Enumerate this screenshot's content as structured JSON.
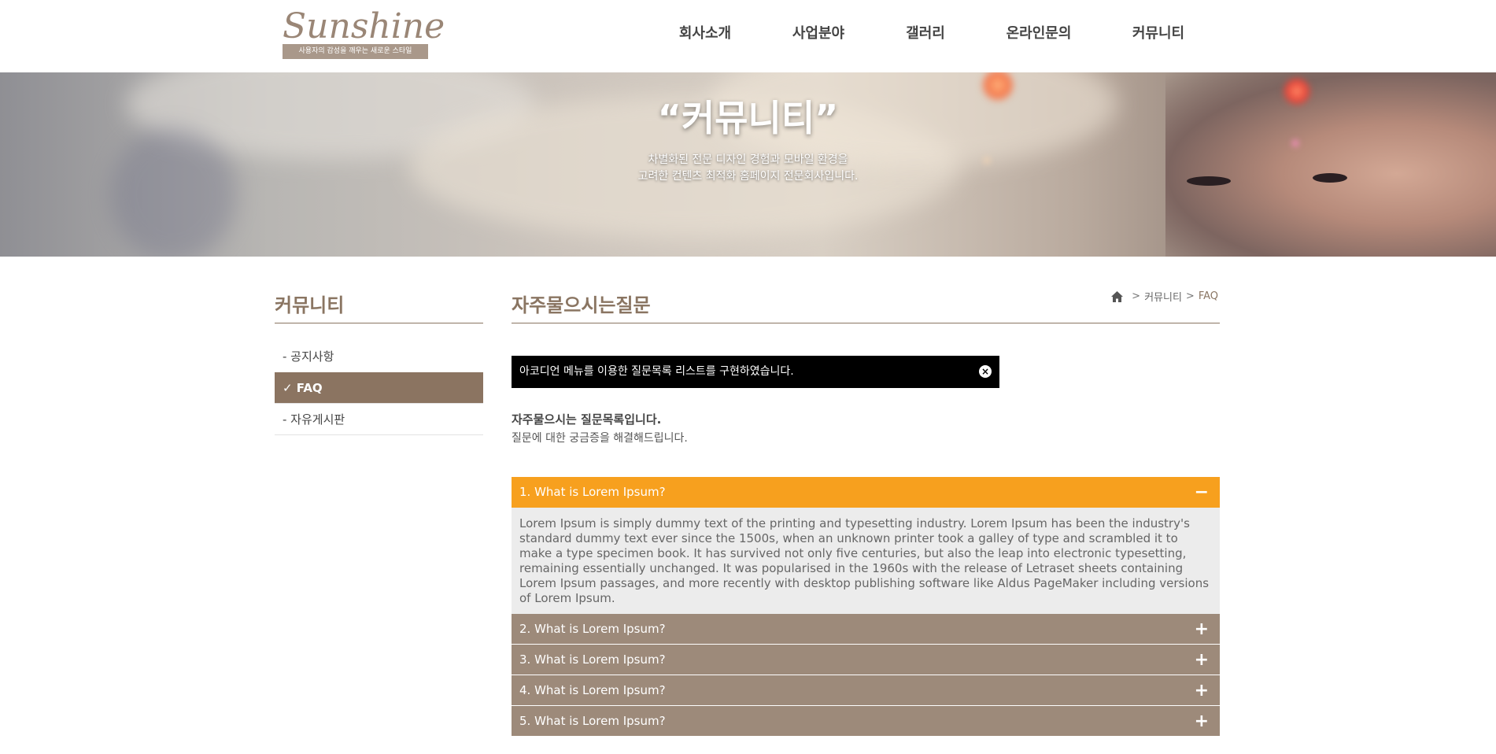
{
  "header": {
    "logo_text": "Sunshine",
    "logo_tagline": "사용자의 감성을 깨우는 새로운 스타일",
    "nav": [
      {
        "label": "회사소개"
      },
      {
        "label": "사업분야"
      },
      {
        "label": "갤러리"
      },
      {
        "label": "온라인문의"
      },
      {
        "label": "커뮤니티"
      }
    ]
  },
  "banner": {
    "title": "“커뮤니티”",
    "subtitle_line1": "차별화된 전문 디자인 경험과 모바일 환경을",
    "subtitle_line2": "고려한 컨텐츠 최적화 홈페이지 전문회사입니다."
  },
  "sidebar": {
    "title": "커뮤니티",
    "items": [
      {
        "label": "- 공지사항",
        "active": false
      },
      {
        "label": "✓ FAQ",
        "active": true
      },
      {
        "label": "- 자유게시판",
        "active": false
      }
    ]
  },
  "main": {
    "title": "자주물으시는질문",
    "breadcrumb": {
      "separator": ">",
      "items": [
        "커뮤니티",
        "FAQ"
      ]
    },
    "notice": {
      "text": "아코디언 메뉴를 이용한 질문목록 리스트를 구현하였습니다.",
      "close_icon": "×"
    },
    "intro_heading": "자주물으시는 질문목록입니다.",
    "intro_text": "질문에 대한 궁금증을 해결해드립니다.",
    "faq": [
      {
        "question": "1. What is Lorem Ipsum?",
        "open": true,
        "toggle": "−",
        "answer": "Lorem Ipsum is simply dummy text of the printing and typesetting industry. Lorem Ipsum has been the industry's standard dummy text ever since the 1500s, when an unknown printer took a galley of type and scrambled it to make a type specimen book. It has survived not only five centuries, but also the leap into electronic typesetting, remaining essentially unchanged. It was popularised in the 1960s with the release of Letraset sheets containing Lorem Ipsum passages, and more recently with desktop publishing software like Aldus PageMaker including versions of Lorem Ipsum."
      },
      {
        "question": "2. What is Lorem Ipsum?",
        "open": false,
        "toggle": "+"
      },
      {
        "question": "3. What is Lorem Ipsum?",
        "open": false,
        "toggle": "+"
      },
      {
        "question": "4. What is Lorem Ipsum?",
        "open": false,
        "toggle": "+"
      },
      {
        "question": "5. What is Lorem Ipsum?",
        "open": false,
        "toggle": "+"
      }
    ]
  },
  "colors": {
    "brand_brown": "#8b7461",
    "accent_orange": "#f7a01e",
    "faq_closed": "#9d8a7a",
    "notice_bg": "#000000"
  },
  "icons": {
    "home": "home-icon",
    "close": "close-icon",
    "check": "check-icon"
  }
}
